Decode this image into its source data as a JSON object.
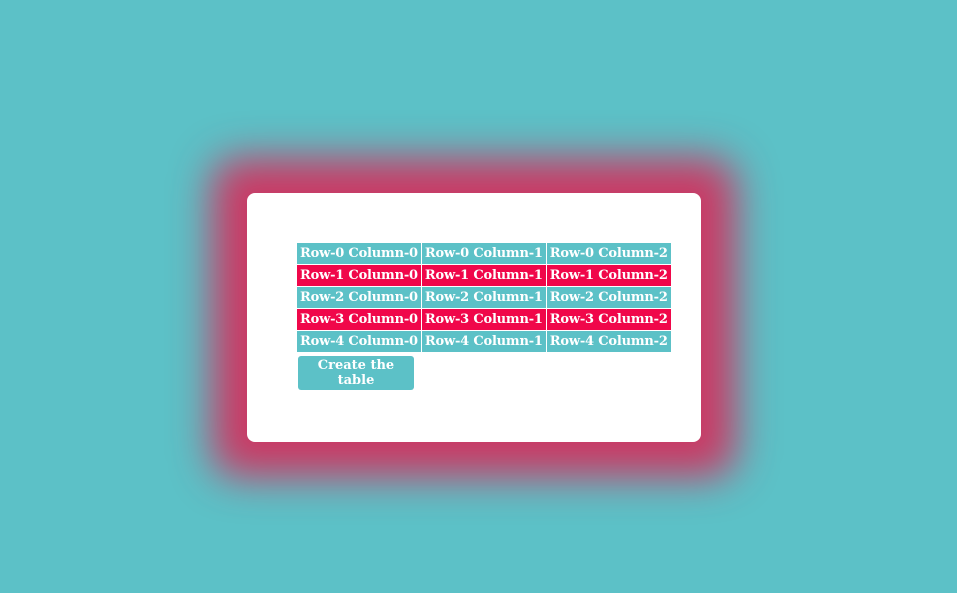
{
  "colors": {
    "background": "#5cc1c7",
    "card": "#ffffff",
    "glow": "#dd2254",
    "row_even": "#5cc1c7",
    "row_odd": "#f0074a"
  },
  "table": {
    "rows": [
      [
        "Row-0 Column-0",
        "Row-0 Column-1",
        "Row-0 Column-2"
      ],
      [
        "Row-1 Column-0",
        "Row-1 Column-1",
        "Row-1 Column-2"
      ],
      [
        "Row-2 Column-0",
        "Row-2 Column-1",
        "Row-2 Column-2"
      ],
      [
        "Row-3 Column-0",
        "Row-3 Column-1",
        "Row-3 Column-2"
      ],
      [
        "Row-4 Column-0",
        "Row-4 Column-1",
        "Row-4 Column-2"
      ]
    ]
  },
  "button": {
    "label": "Create the table"
  }
}
